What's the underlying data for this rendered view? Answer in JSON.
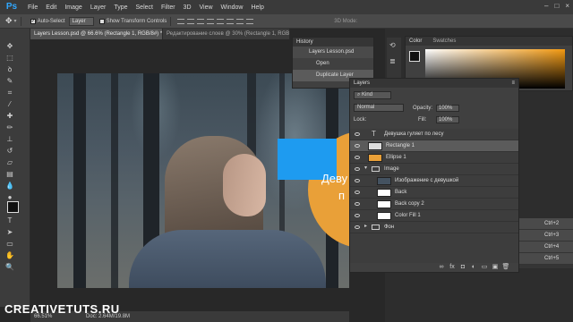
{
  "app": {
    "logo": "Ps"
  },
  "menu": [
    "File",
    "Edit",
    "Image",
    "Layer",
    "Type",
    "Select",
    "Filter",
    "3D",
    "View",
    "Window",
    "Help"
  ],
  "window_controls": [
    "–",
    "□",
    "×"
  ],
  "options": {
    "auto_select": "Auto-Select",
    "auto_select_target": "Layer",
    "transform": "Show Transform Controls",
    "mode_3d": "3D Mode:"
  },
  "tabs": [
    {
      "label": "Layers Lesson.psd @ 66.6% (Rectangle 1, RGB/8#) *"
    },
    {
      "label": "Редактирование слоев @ 30% (Rectangle 1, RGB"
    }
  ],
  "canvas": {
    "overlay_line1": "Деву",
    "overlay_line2": "п"
  },
  "status": {
    "zoom": "66.51%",
    "doc": "Doc: 2.64M/19.8M"
  },
  "watermark": "CREATIVETUTS.RU",
  "history": {
    "title": "History",
    "items": [
      "Layers Lesson.psd",
      "Open",
      "Duplicate Layer"
    ]
  },
  "color": {
    "tabs": [
      "Color",
      "Swatches"
    ]
  },
  "layers": {
    "title": "Layers",
    "kind": "Kind",
    "blend_mode": "Normal",
    "opacity_label": "Opacity:",
    "opacity_value": "100%",
    "lock_label": "Lock:",
    "fill_label": "Fill:",
    "fill_value": "100%",
    "rows": [
      {
        "name": "Девушка гуляет  по лесу",
        "type": "text"
      },
      {
        "name": "Rectangle 1",
        "type": "shape",
        "selected": true
      },
      {
        "name": "Ellipse 1",
        "type": "shape"
      },
      {
        "name": "Image",
        "type": "group"
      },
      {
        "name": "Изображение с девушкой",
        "type": "image"
      },
      {
        "name": "Back",
        "type": "white"
      },
      {
        "name": "Back copy 2",
        "type": "white"
      },
      {
        "name": "Color Fill 1",
        "type": "white"
      },
      {
        "name": "Фон",
        "type": "group"
      }
    ],
    "footer_icons": [
      "link-icon",
      "fx-icon",
      "mask-icon",
      "adjustment-icon",
      "folder-icon",
      "new-layer-icon",
      "trash-icon"
    ],
    "footer_glyphs": [
      "∞",
      "fx",
      "◘",
      "◐",
      "▭",
      "▣",
      "🗑"
    ]
  },
  "actions": {
    "items": [
      "Ctrl+2",
      "Ctrl+3",
      "Ctrl+4",
      "Ctrl+5"
    ]
  },
  "colors": {
    "accent_blue": "#1e9bf0",
    "ellipse_orange": "#e9a038",
    "selected_row": "#5b5b5b"
  }
}
